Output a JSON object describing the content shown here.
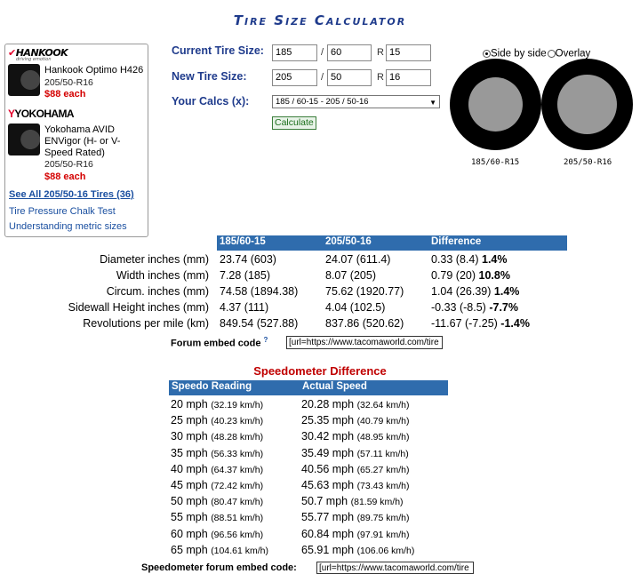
{
  "title": "Tire Size Calculator",
  "sidebar": {
    "ads": [
      {
        "brand_main": "HANKOOK",
        "brand_tag": "driving emotion",
        "name": "Hankook Optimo H426",
        "size": "205/50-R16",
        "price": "$88 each"
      },
      {
        "brand_main": "YOKOHAMA",
        "name": "Yokohama AVID ENVigor (H- or V-Speed Rated)",
        "size": "205/50-R16",
        "price": "$88 each"
      }
    ],
    "see_all": "See All 205/50-16 Tires (36)",
    "links": [
      "Tire Pressure Chalk Test",
      "Understanding metric sizes"
    ]
  },
  "form": {
    "current_label": "Current Tire Size:",
    "current": {
      "width": "185",
      "aspect": "60",
      "rim": "15"
    },
    "new_label": "New Tire Size:",
    "new": {
      "width": "205",
      "aspect": "50",
      "rim": "16"
    },
    "sep_slash": "/",
    "sep_r": "R",
    "calcs_label": "Your Calcs (x):",
    "calcs_value": "185 / 60-15 - 205 / 50-16",
    "calculate_button": "Calculate"
  },
  "view": {
    "options": [
      "Side by side",
      "Overlay"
    ],
    "selected": "Side by side",
    "tire_labels": [
      "185/60-R15",
      "205/50-R16"
    ]
  },
  "comparison": {
    "headers": [
      "185/60-15",
      "205/50-16",
      "Difference"
    ],
    "rows": [
      {
        "label": "Diameter inches (mm)",
        "a": "23.74 (603)",
        "b": "24.07 (611.4)",
        "diff": "0.33 (8.4)",
        "pct": "1.4%"
      },
      {
        "label": "Width inches (mm)",
        "a": "7.28 (185)",
        "b": "8.07 (205)",
        "diff": "0.79 (20)",
        "pct": "10.8%"
      },
      {
        "label": "Circum. inches (mm)",
        "a": "74.58 (1894.38)",
        "b": "75.62 (1920.77)",
        "diff": "1.04 (26.39)",
        "pct": "1.4%"
      },
      {
        "label": "Sidewall Height inches (mm)",
        "a": "4.37 (111)",
        "b": "4.04 (102.5)",
        "diff": "-0.33 (-8.5)",
        "pct": "-7.7%"
      },
      {
        "label": "Revolutions per mile (km)",
        "a": "849.54 (527.88)",
        "b": "837.86 (520.62)",
        "diff": "-11.67 (-7.25)",
        "pct": "-1.4%"
      }
    ],
    "embed_label": "Forum embed code",
    "embed_help": "?",
    "embed_value": "[url=https://www.tacomaworld.com/tire"
  },
  "speedo": {
    "title": "Speedometer Difference",
    "headers": [
      "Speedo Reading",
      "Actual Speed"
    ],
    "rows": [
      {
        "r_main": "20 mph",
        "r_km": "(32.19 km/h)",
        "a_main": "20.28 mph",
        "a_km": "(32.64 km/h)"
      },
      {
        "r_main": "25 mph",
        "r_km": "(40.23 km/h)",
        "a_main": "25.35 mph",
        "a_km": "(40.79 km/h)"
      },
      {
        "r_main": "30 mph",
        "r_km": "(48.28 km/h)",
        "a_main": "30.42 mph",
        "a_km": "(48.95 km/h)"
      },
      {
        "r_main": "35 mph",
        "r_km": "(56.33 km/h)",
        "a_main": "35.49 mph",
        "a_km": "(57.11 km/h)"
      },
      {
        "r_main": "40 mph",
        "r_km": "(64.37 km/h)",
        "a_main": "40.56 mph",
        "a_km": "(65.27 km/h)"
      },
      {
        "r_main": "45 mph",
        "r_km": "(72.42 km/h)",
        "a_main": "45.63 mph",
        "a_km": "(73.43 km/h)"
      },
      {
        "r_main": "50 mph",
        "r_km": "(80.47 km/h)",
        "a_main": "50.7 mph",
        "a_km": "(81.59 km/h)"
      },
      {
        "r_main": "55 mph",
        "r_km": "(88.51 km/h)",
        "a_main": "55.77 mph",
        "a_km": "(89.75 km/h)"
      },
      {
        "r_main": "60 mph",
        "r_km": "(96.56 km/h)",
        "a_main": "60.84 mph",
        "a_km": "(97.91 km/h)"
      },
      {
        "r_main": "65 mph",
        "r_km": "(104.61 km/h)",
        "a_main": "65.91 mph",
        "a_km": "(106.06 km/h)"
      }
    ],
    "embed_label": "Speedometer forum embed code:",
    "embed_value": "[url=https://www.tacomaworld.com/tire"
  }
}
